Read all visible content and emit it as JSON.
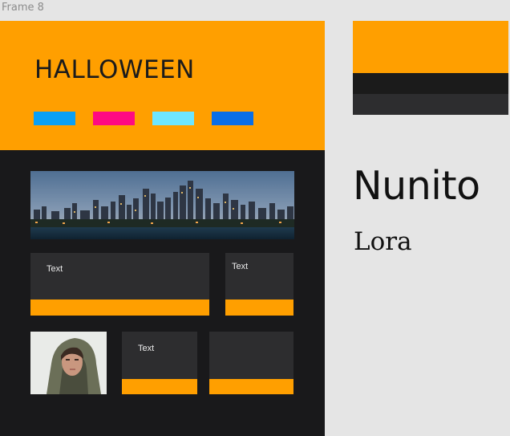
{
  "canvas": {
    "frame_label": "Frame 8"
  },
  "design": {
    "title": "HALLOWEEN",
    "swatches": [
      {
        "name": "sky-blue",
        "color": "#0aa0f5"
      },
      {
        "name": "magenta",
        "color": "#ff0a82"
      },
      {
        "name": "cyan",
        "color": "#6ee6ff"
      },
      {
        "name": "blue",
        "color": "#0a6ee6"
      }
    ],
    "hero_image": "city-skyline-night-image",
    "cards": [
      {
        "label": "Text"
      },
      {
        "label": "Text"
      },
      {
        "label": "Text"
      },
      {
        "label": ""
      }
    ],
    "portrait_image": "hooded-woman-portrait-image"
  },
  "palette": [
    "#ff9f00",
    "#1b1b1b",
    "#2d2d2f"
  ],
  "fonts": {
    "primary": "Nunito",
    "secondary": "Lora"
  },
  "colors": {
    "accent": "#ff9f00",
    "background_dark": "#19191b",
    "card": "#2d2d2f",
    "canvas": "#e5e5e5"
  }
}
